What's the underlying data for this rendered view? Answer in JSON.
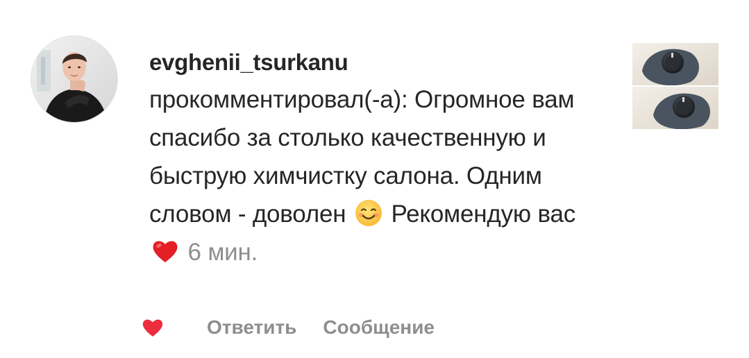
{
  "comment": {
    "username": "evghenii_tsurkanu",
    "text_before_first_emoji": "прокомментировал(-а): Огромное вам спасибо за столько качественную и быструю химчистку салона. Одним словом - доволен ",
    "first_emoji": "smiling-face-icon",
    "text_between_emojis": " Рекомендую вас ",
    "second_emoji": "red-heart-icon",
    "time": " 6 мин."
  },
  "actions": {
    "like_icon": "heart-icon",
    "reply_label": "Ответить",
    "message_label": "Сообщение"
  },
  "colors": {
    "text": "#262626",
    "muted": "#8e8e8e",
    "heart": "#ed2c3e",
    "background": "#ffffff"
  }
}
